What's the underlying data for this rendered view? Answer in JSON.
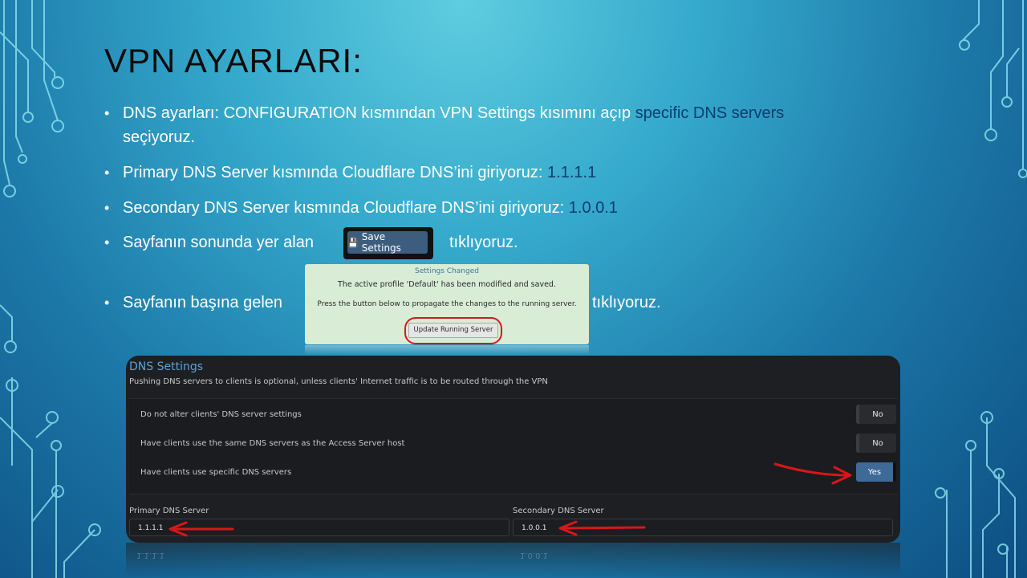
{
  "slide": {
    "title": "VPN AYARLARI:",
    "bullet_symbol": "•",
    "bullets": [
      {
        "text_a": "DNS ayarları: CONFIGURATION kısmından VPN Settings kısımını açıp ",
        "highlight": "specific DNS servers",
        "text_b": "seçiyoruz."
      },
      {
        "text_a": "Primary DNS Server kısmında Cloudflare DNS’ini giriyoruz: ",
        "highlight": "1.1.1.1"
      },
      {
        "text_a": "Secondary DNS Server kısmında Cloudflare DNS’ini giriyoruz: ",
        "highlight": "1.0.0.1"
      },
      {
        "text_a": "Sayfanın sonunda yer alan",
        "text_b": "tıklıyoruz."
      },
      {
        "text_a": "Sayfanın başına gelen",
        "text_b": "tıklıyoruz."
      }
    ]
  },
  "save_button": {
    "icon": "save-icon",
    "label": "Save Settings"
  },
  "settings_changed": {
    "title": "Settings Changed",
    "line1": "The active profile 'Default' has been modified and saved.",
    "line2": "Press the button below to propagate the changes to the running server.",
    "button_label": "Update Running Server"
  },
  "dns_panel": {
    "title": "DNS Settings",
    "subtitle": "Pushing DNS servers to clients is optional, unless clients' Internet traffic is to be routed through the VPN",
    "options": [
      {
        "label": "Do not alter clients' DNS server settings",
        "toggle": "No"
      },
      {
        "label": "Have clients use the same DNS servers as the Access Server host",
        "toggle": "No"
      },
      {
        "label": "Have clients use specific DNS servers",
        "toggle": "Yes"
      }
    ],
    "primary_label": "Primary DNS Server",
    "primary_value": "1.1.1.1",
    "secondary_label": "Secondary DNS Server",
    "secondary_value": "1.0.0.1"
  },
  "colors": {
    "highlight_text": "#0e3d6e",
    "annotation_red": "#d8161b",
    "panel_accent": "#5aa3db",
    "yes_toggle": "#3d6a96"
  }
}
